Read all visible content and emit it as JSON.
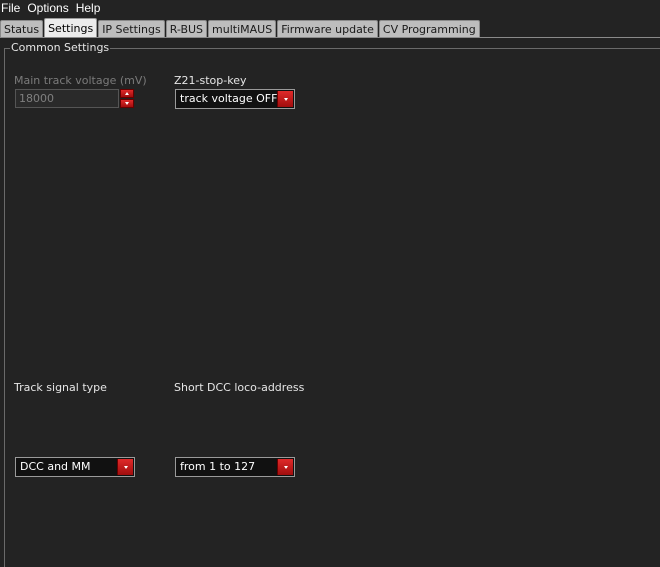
{
  "menu": [
    "File",
    "Options",
    "Help"
  ],
  "tabs": [
    "Status",
    "Settings",
    "IP Settings",
    "R-BUS",
    "multiMAUS",
    "Firmware update",
    "CV Programming"
  ],
  "active_tab": "Settings",
  "group": {
    "title": "Common Settings"
  },
  "main_track_voltage": {
    "label": "Main track voltage (mV)",
    "value": "18000",
    "disabled": true
  },
  "stop_key": {
    "label": "Z21-stop-key",
    "value": "track voltage OFF"
  },
  "track_signal": {
    "label": "Track signal type",
    "value": "DCC and MM"
  },
  "short_dcc": {
    "label": "Short DCC loco-address",
    "value": "from 1 to 127"
  },
  "colors": {
    "accent": "#c8101a",
    "background": "#232323",
    "tab_active": "#ececec",
    "tab_inactive": "#bdbdbd"
  }
}
